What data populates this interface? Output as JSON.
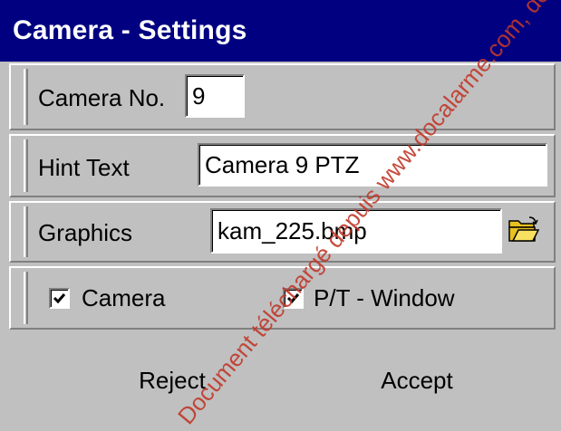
{
  "window": {
    "title": "Camera - Settings"
  },
  "camera_no": {
    "label": "Camera No.",
    "value": "9"
  },
  "hint_text": {
    "label": "Hint Text",
    "value": "Camera 9 PTZ"
  },
  "graphics": {
    "label": "Graphics",
    "value": "kam_225.bmp",
    "browse_icon": "open-folder-icon"
  },
  "options": {
    "camera": {
      "label": "Camera",
      "checked": true
    },
    "ptwindow": {
      "label": "P/T - Window",
      "checked": true
    }
  },
  "buttons": {
    "reject": "Reject",
    "accept": "Accept"
  },
  "watermark": "Document téléchargé depuis www.docalarme.com, de la documentation",
  "colors": {
    "titlebar": "#000080",
    "face": "#c0c0c0",
    "watermark": "#c0392b"
  }
}
